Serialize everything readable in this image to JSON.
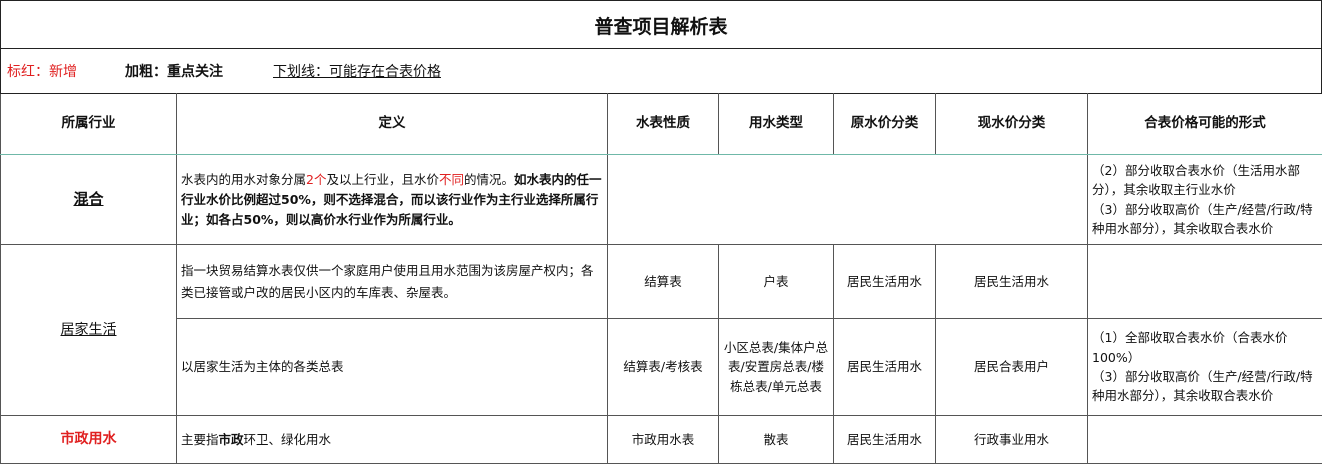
{
  "title": "普查项目解析表",
  "legend": {
    "red": "标红：新增",
    "bold": "加粗：重点关注",
    "underline": "下划线：可能存在合表价格"
  },
  "headers": [
    "所属行业",
    "定义",
    "水表性质",
    "用水类型",
    "原水价分类",
    "现水价分类",
    "合表价格可能的形式"
  ],
  "rows": {
    "mixed": {
      "industry": "混合",
      "def_a": "水表内的用水对象分属",
      "def_red1": "2个",
      "def_b": "及以上行业，且水价",
      "def_red2": "不同",
      "def_c": "的情况。",
      "def_bold": "如水表内的任一行业水价比例超过50%，则不选择混合，而以该行业作为主行业选择所属行业；如各占50%，则以高价水行业作为所属行业。",
      "price1": "（2）部分收取合表水价（生活用水部分），其余收取主行业水价",
      "price2": "（3）部分收取高价（生产/经营/行政/特种用水部分），其余收取合表水价"
    },
    "household": {
      "industry": "居家生活",
      "r1": {
        "def": "指一块贸易结算水表仅供一个家庭用户使用且用水范围为该房屋产权内；各类已接管或户改的居民小区内的车库表、杂屋表。",
        "meter": "结算表",
        "usage": "户表",
        "orig": "居民生活用水",
        "curr": "居民生活用水",
        "price": ""
      },
      "r2": {
        "def": "以居家生活为主体的各类总表",
        "meter": "结算表/考核表",
        "usage": "小区总表/集体户总表/安置房总表/楼栋总表/单元总表",
        "orig": "居民生活用水",
        "curr": "居民合表用户",
        "price1": "（1）全部收取合表水价（合表水价100%）",
        "price2": "（3）部分收取高价（生产/经营/行政/特种用水部分），其余收取合表水价"
      }
    },
    "municipal": {
      "industry": "市政用水",
      "def_a": "主要指",
      "def_bold": "市政",
      "def_b": "环卫、绿化用水",
      "meter": "市政用水表",
      "usage": "散表",
      "orig": "居民生活用水",
      "curr": "行政事业用水",
      "price": ""
    }
  }
}
